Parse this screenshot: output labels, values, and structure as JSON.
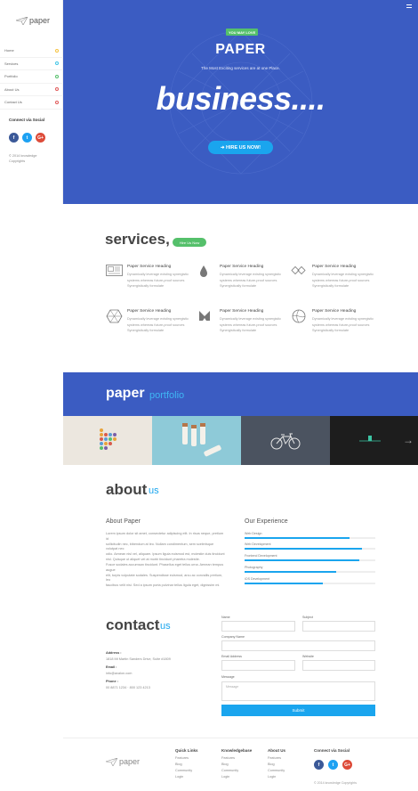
{
  "sidebar": {
    "logo_text": "paper",
    "nav": [
      {
        "label": "Home",
        "dot_color": "#f5c342"
      },
      {
        "label": "Services",
        "dot_color": "#42c5e6"
      },
      {
        "label": "Portfolio",
        "dot_color": "#55c06b"
      },
      {
        "label": "About Us",
        "dot_color": "#e05a5a"
      },
      {
        "label": "Contact Us",
        "dot_color": "#e05a5a"
      }
    ],
    "connect_title": "Connect via Social",
    "social": [
      "f",
      "t",
      "G+"
    ],
    "copyright_line1": "© 2014 knowledge",
    "copyright_line2": "Copyrights"
  },
  "hero": {
    "badge": "YOU MAY LOVE",
    "title": "PAPER",
    "subtitle": "The Most Exciting services are at one Place.",
    "big_text": "business....",
    "button": "➜ HIRE US NOW!"
  },
  "services": {
    "title": "services,",
    "button": "Hire Us Now",
    "items": [
      {
        "icon": "newspaper-icon",
        "heading": "Paper Service Heading",
        "line1": "Dynamically leverage existing synergistic",
        "line2": "systems whereas future-proof sources",
        "line3": "Synergistically formulate"
      },
      {
        "icon": "drop-icon",
        "heading": "Paper Service Heading",
        "line1": "Dynamically leverage existing synergistic",
        "line2": "systems whereas future-proof sources",
        "line3": "Synergistically formulate"
      },
      {
        "icon": "link-icon",
        "heading": "Paper Service Heading",
        "line1": "Dynamically leverage existing synergistic",
        "line2": "systems whereas future-proof sources",
        "line3": "Synergistically formulate"
      },
      {
        "icon": "hexagon-icon",
        "heading": "Paper Service Heading",
        "line1": "Dynamically leverage existing synergistic",
        "line2": "systems whereas future-proof sources",
        "line3": "Synergistically formulate"
      },
      {
        "icon": "leaf-icon",
        "heading": "Paper Service Heading",
        "line1": "Dynamically leverage existing synergistic",
        "line2": "systems whereas future-proof sources",
        "line3": "Synergistically formulate"
      },
      {
        "icon": "globe-icon",
        "heading": "Paper Service Heading",
        "line1": "Dynamically leverage existing synergistic",
        "line2": "systems whereas future-proof sources",
        "line3": "Synergistically formulate"
      }
    ]
  },
  "portfolio": {
    "title": "paper",
    "subtitle": "portfolio"
  },
  "about": {
    "title": "about",
    "title_accent": "us",
    "heading": "About Paper",
    "para1": [
      "Lorem ipsum dolor sit amet, consectetur adipiscing elit. In risus neque, pretium id",
      "sollicitudin nec, bibendum at leo. Nullam condimentum, sem scelerisque volutpat nec",
      "odio. Aenean nisl vel, aliquam. Ipsum ligula euismod est, molestie duis tincidunt",
      "nisl. Quisque ut aliquet vel at morbi tincidunt pharetra molestie."
    ],
    "para2": [
      "Fusce sodales accumsan tincidunt. Phasellus eget tellus urna. Aenean tempus augue",
      "elit, turpis vulputate sodales. Suspendisse euismod, arcu ac convallis pretium, leo",
      "faucibus velit nisi. Sed a ipsum porta pulvinar tellus ligula eget, dignissim mi."
    ],
    "experience_heading": "Our Experience",
    "skills": [
      {
        "label": "Web Design",
        "percent": 80
      },
      {
        "label": "Web Development",
        "percent": 90
      },
      {
        "label": "Frontend Development",
        "percent": 88
      },
      {
        "label": "Photography",
        "percent": 70
      },
      {
        "label": "iOS Development",
        "percent": 60
      }
    ]
  },
  "contact": {
    "title": "contact",
    "title_accent": "us",
    "address_label": "Address :",
    "address": "1818 Mt Martin Sanders Drive, Suite #1809",
    "email_label": "Email :",
    "email": "info@avalon.com",
    "phone_label": "Phone :",
    "phone": "00 8871 1234 · 800 123 4213",
    "form": {
      "name": "Name",
      "subject": "Subject",
      "company": "Company Name",
      "email": "Email Address",
      "website": "Website",
      "message": "Message",
      "message_placeholder": "Message",
      "submit": "Submit"
    }
  },
  "footer": {
    "logo_text": "paper",
    "columns": [
      {
        "heading": "Quick Links",
        "items": [
          "Features",
          "Blog",
          "Community",
          "Login"
        ]
      },
      {
        "heading": "Knowledgebase",
        "items": [
          "Features",
          "Blog",
          "Community",
          "Login"
        ]
      },
      {
        "heading": "About Us",
        "items": [
          "Features",
          "Blog",
          "Community",
          "Login"
        ]
      }
    ],
    "connect_title": "Connect via Social",
    "social": [
      "f",
      "t",
      "G+"
    ],
    "copyright": "© 2014 knowledge Copyrights"
  }
}
